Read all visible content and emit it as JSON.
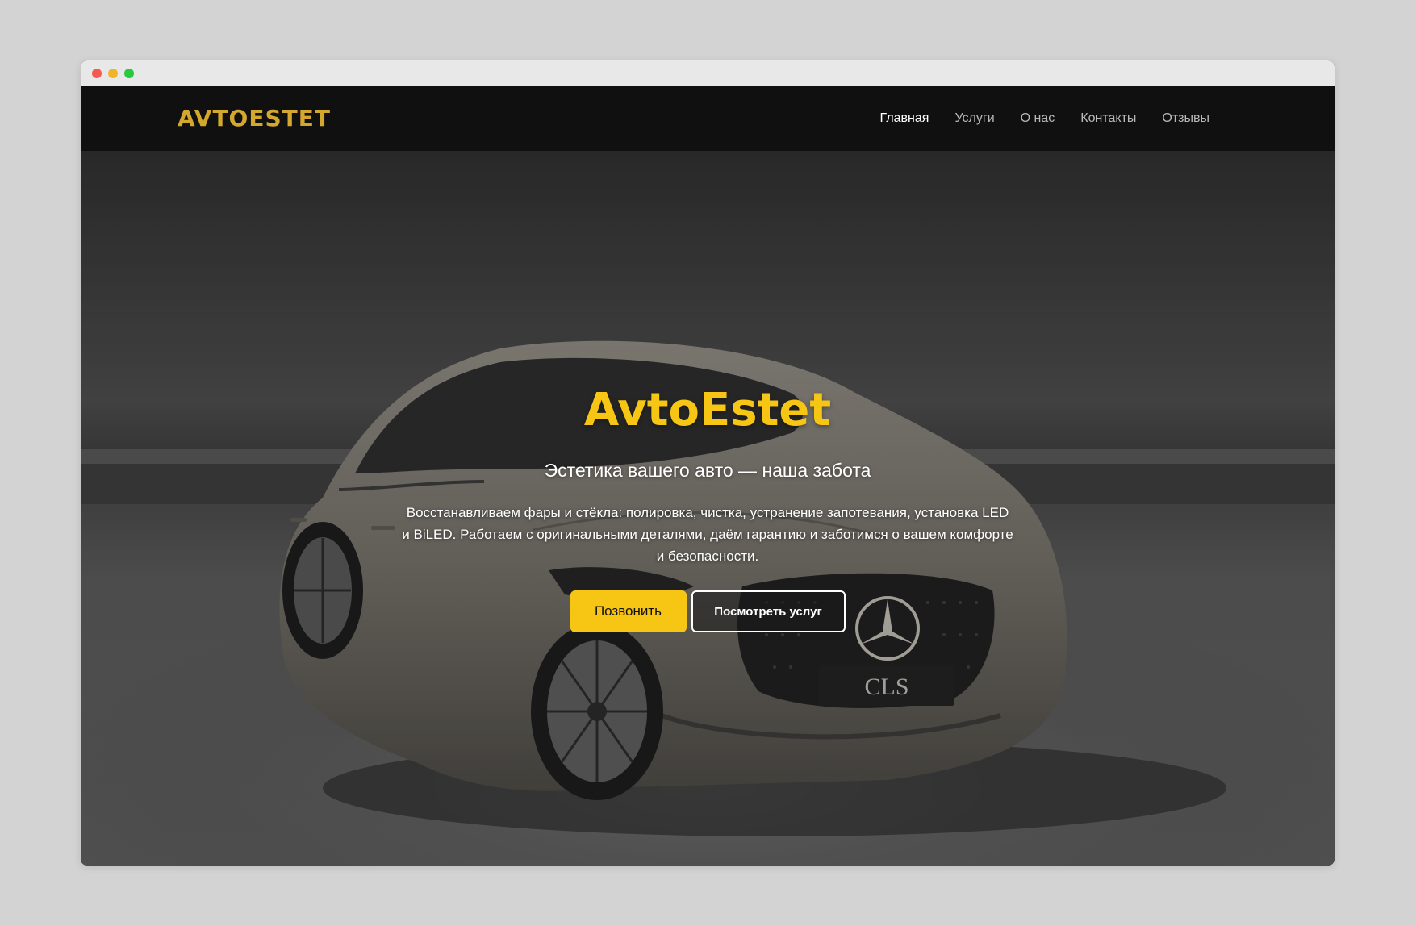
{
  "colors": {
    "brand_gold": "#d4a82c",
    "accent_yellow": "#f7c615",
    "nav_active": "#ffffff",
    "nav_inactive": "#b8b8b8"
  },
  "window": {
    "controls": [
      "close",
      "minimize",
      "maximize"
    ]
  },
  "header": {
    "logo": "AVTOESTET",
    "nav": [
      {
        "label": "Главная",
        "active": true
      },
      {
        "label": "Услуги",
        "active": false
      },
      {
        "label": "О нас",
        "active": false
      },
      {
        "label": "Контакты",
        "active": false
      },
      {
        "label": "Отзывы",
        "active": false
      }
    ]
  },
  "hero": {
    "title": "AvtoEstet",
    "subtitle": "Эстетика вашего авто — наша забота",
    "description": "Восстанавливаем фары и стёкла: полировка, чистка, устранение запотевания, установка LED и BiLED. Работаем с оригинальными деталями, даём гарантию и заботимся о вашем комфорте и безопасности.",
    "plate_text": "CLS",
    "buttons": {
      "call": "Позвонить",
      "services": "Посмотреть услуг"
    }
  }
}
